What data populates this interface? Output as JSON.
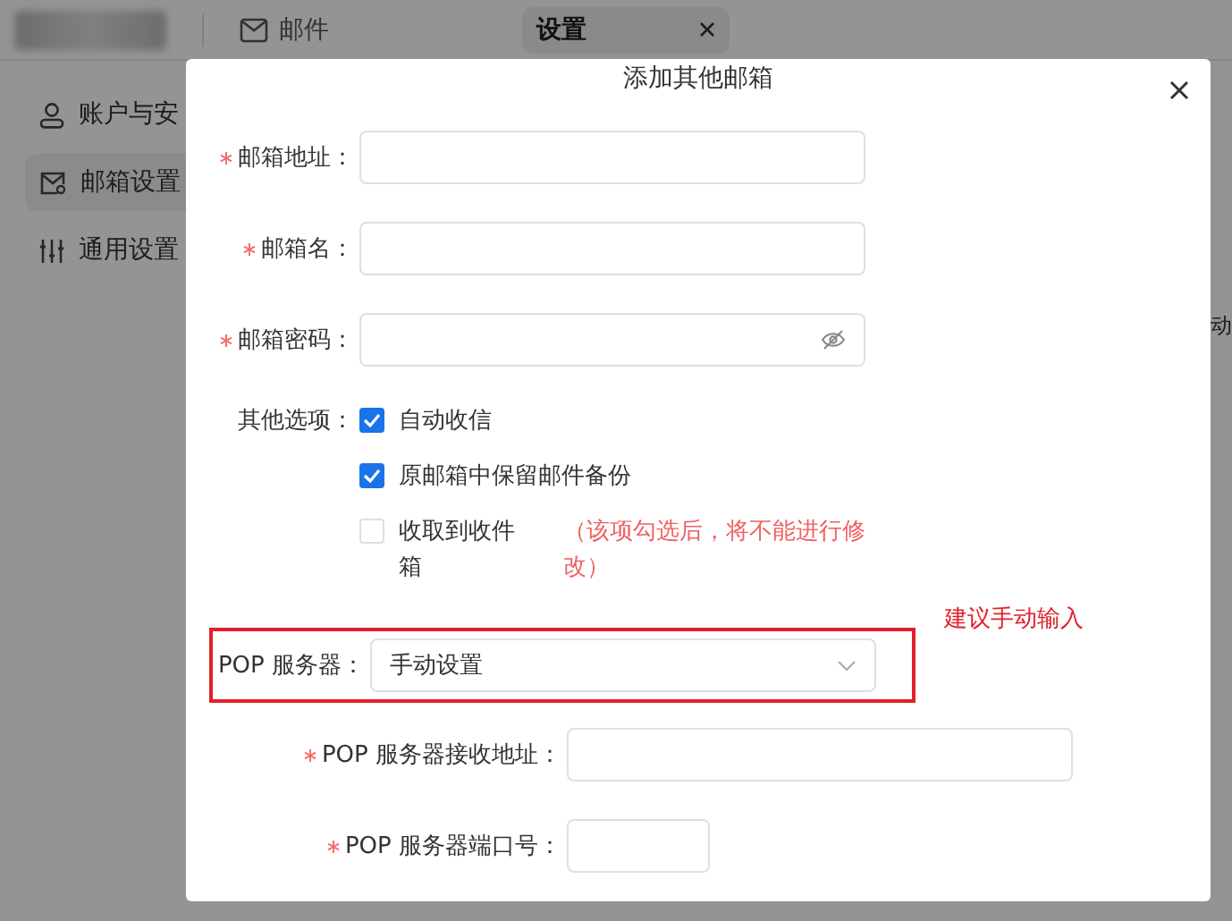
{
  "app": {
    "tabs": [
      {
        "label": "邮件",
        "selected": false,
        "closable": false
      },
      {
        "label": "设置",
        "selected": true,
        "closable": true
      }
    ],
    "sidebar": {
      "items": [
        {
          "label": "账户与安",
          "selected": false
        },
        {
          "label": "邮箱设置",
          "selected": true
        },
        {
          "label": "通用设置",
          "selected": false
        }
      ]
    },
    "edge_text": "动"
  },
  "dialog": {
    "title": "添加其他邮箱",
    "fields": [
      {
        "label": "邮箱地址：",
        "required": true,
        "kind": "text"
      },
      {
        "label": "邮箱名：",
        "required": true,
        "kind": "text"
      },
      {
        "label": "邮箱密码：",
        "required": true,
        "kind": "password"
      }
    ],
    "options": {
      "label": "其他选项：",
      "items": [
        {
          "label": "自动收信",
          "checked": true
        },
        {
          "label": "原邮箱中保留邮件备份",
          "checked": true
        },
        {
          "label": "收取到收件箱",
          "checked": false,
          "note": "（该项勾选后，将不能进行修改）"
        }
      ]
    },
    "pop_server": {
      "label": "POP 服务器：",
      "value": "手动设置",
      "highlighted": true,
      "annotation": "建议手动输入"
    },
    "pop_fields": [
      {
        "label": "POP 服务器接收地址：",
        "required": true
      },
      {
        "label": "POP 服务器端口号：",
        "required": true
      }
    ]
  }
}
